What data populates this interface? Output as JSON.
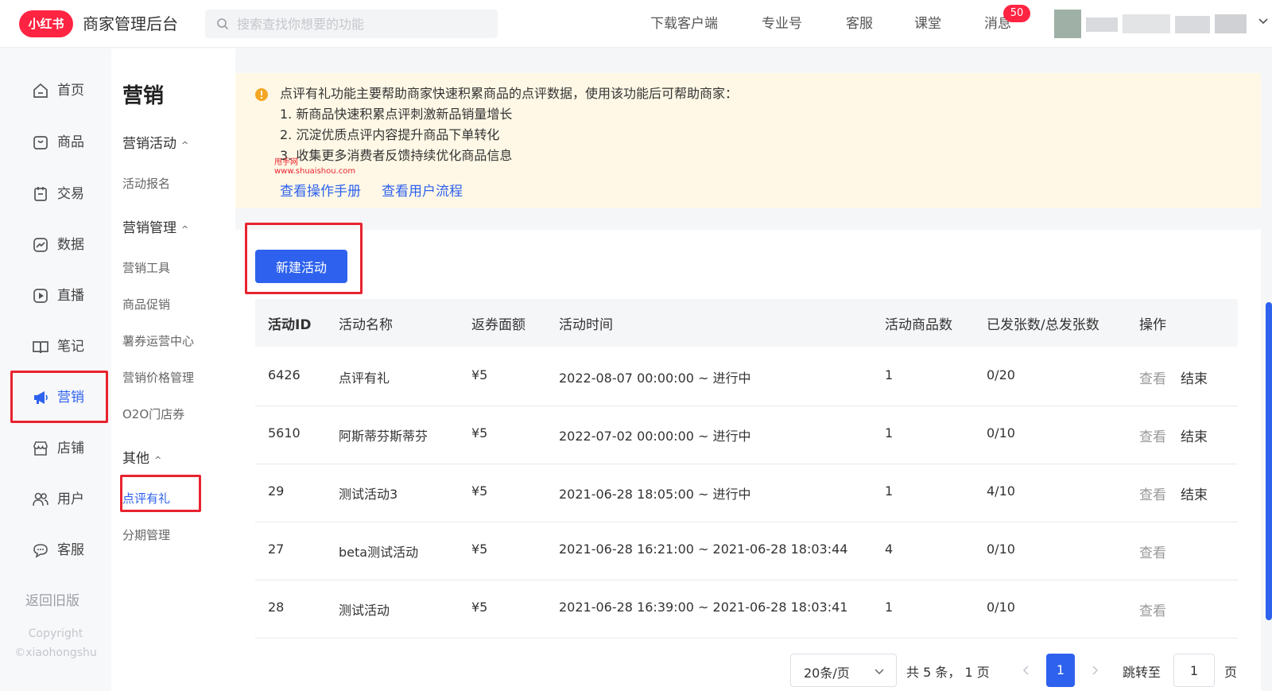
{
  "header": {
    "logo_text": "小红书",
    "app_title": "商家管理后台",
    "search_placeholder": "搜索查找你想要的功能",
    "nav": [
      "下载客户端",
      "专业号",
      "客服",
      "课堂",
      "消息"
    ],
    "message_badge": "50"
  },
  "leftnav": {
    "items": [
      "首页",
      "商品",
      "交易",
      "数据",
      "直播",
      "笔记",
      "营销",
      "店铺",
      "用户",
      "客服"
    ],
    "active": "营销",
    "back_old": "返回旧版",
    "copyright_1": "Copyright",
    "copyright_2": "©xiaohongshu"
  },
  "subnav": {
    "title": "营销",
    "groups": [
      {
        "label": "营销活动",
        "items": [
          "活动报名"
        ]
      },
      {
        "label": "营销管理",
        "items": [
          "营销工具",
          "商品促销",
          "薯券运营中心",
          "营销价格管理",
          "O2O门店券"
        ]
      },
      {
        "label": "其他",
        "items": [
          "点评有礼",
          "分期管理"
        ]
      }
    ],
    "active_item": "点评有礼"
  },
  "notice": {
    "lines": [
      "点评有礼功能主要帮助商家快速积累商品的点评数据，使用该功能后可帮助商家：",
      "1. 新商品快速积累点评刺激新品销量增长",
      "2. 沉淀优质点评内容提升商品下单转化",
      "3. 收集更多消费者反馈持续优化商品信息"
    ],
    "links": [
      "查看操作手册",
      "查看用户流程"
    ],
    "watermark_1": "甩手网",
    "watermark_2": "www.shuaishou.com"
  },
  "main": {
    "new_button": "新建活动",
    "columns": [
      "活动ID",
      "活动名称",
      "返券面额",
      "活动时间",
      "活动商品数",
      "已发张数/总发张数",
      "操作"
    ],
    "rows": [
      {
        "id": "6426",
        "name": "点评有礼",
        "amount": "¥5",
        "time": "2022-08-07 00:00:00 ~ 进行中",
        "count": "1",
        "issued": "0/20",
        "view": "查看",
        "end": "结束"
      },
      {
        "id": "5610",
        "name": "阿斯蒂芬斯蒂芬",
        "amount": "¥5",
        "time": "2022-07-02 00:00:00 ~ 进行中",
        "count": "1",
        "issued": "0/10",
        "view": "查看",
        "end": "结束"
      },
      {
        "id": "29",
        "name": "测试活动3",
        "amount": "¥5",
        "time": "2021-06-28 18:05:00 ~ 进行中",
        "count": "1",
        "issued": "4/10",
        "view": "查看",
        "end": "结束"
      },
      {
        "id": "27",
        "name": "beta测试活动",
        "amount": "¥5",
        "time": "2021-06-28 16:21:00 ~ 2021-06-28 18:03:44",
        "count": "4",
        "issued": "0/10",
        "view": "查看",
        "end": ""
      },
      {
        "id": "28",
        "name": "测试活动",
        "amount": "¥5",
        "time": "2021-06-28 16:39:00 ~ 2021-06-28 18:03:41",
        "count": "1",
        "issued": "0/10",
        "view": "查看",
        "end": ""
      }
    ]
  },
  "pagination": {
    "page_size": "20条/页",
    "total": "共 5 条， 1 页",
    "current": "1",
    "jump_label": "跳转至",
    "jump_value": "1",
    "unit": "页"
  },
  "colors": {
    "accent": "#2e62ee",
    "brand": "#ff2442",
    "highlight_box": "#e8232f",
    "notice_bg": "#fff8e6"
  }
}
